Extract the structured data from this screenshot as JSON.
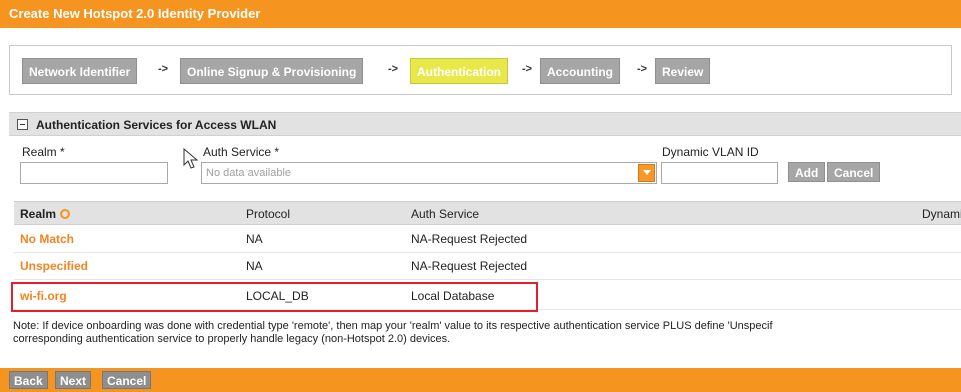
{
  "dialog": {
    "title": "Create New Hotspot 2.0 Identity Provider"
  },
  "wizard": {
    "steps": [
      "Network Identifier",
      "Online Signup & Provisioning",
      "Authentication",
      "Accounting",
      "Review"
    ],
    "active_step": "Authentication",
    "separator": "->"
  },
  "section": {
    "title": "Authentication Services for Access WLAN"
  },
  "form": {
    "realm_label": "Realm *",
    "realm_value": "",
    "auth_service_label": "Auth Service *",
    "auth_service_placeholder": "No data available",
    "vlan_label": "Dynamic VLAN ID",
    "vlan_value": "",
    "add_label": "Add",
    "cancel_label": "Cancel"
  },
  "table": {
    "headers": [
      "Realm",
      "Protocol",
      "Auth Service",
      "Dynami"
    ],
    "rows": [
      {
        "realm": "No Match",
        "protocol": "NA",
        "auth_service": "NA-Request Rejected"
      },
      {
        "realm": "Unspecified",
        "protocol": "NA",
        "auth_service": "NA-Request Rejected"
      },
      {
        "realm": "wi-fi.org",
        "protocol": "LOCAL_DB",
        "auth_service": "Local Database"
      }
    ]
  },
  "note": {
    "line1": "Note: If device onboarding was done with credential type 'remote', then map your 'realm' value to its respective authentication service PLUS define 'Unspecif",
    "line2": "corresponding authentication service to properly handle legacy (non-Hotspot 2.0) devices."
  },
  "footer": {
    "back_label": "Back",
    "next_label": "Next",
    "cancel_label": "Cancel"
  },
  "colors": {
    "accent": "#f5941f",
    "active_step": "#e9e84a",
    "highlight": "#e0202f",
    "realm_link": "#f5841f"
  }
}
